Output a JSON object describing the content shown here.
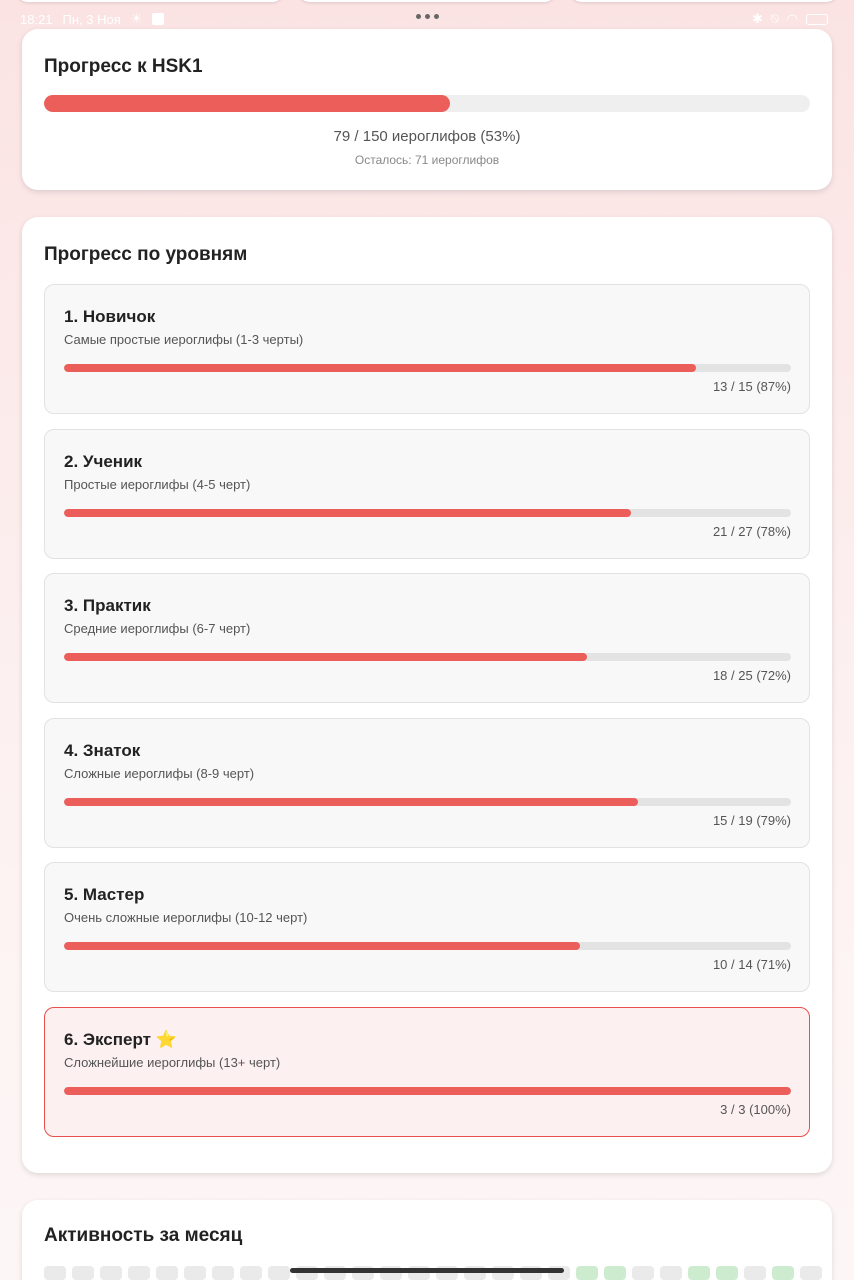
{
  "status_bar": {
    "time": "18:21",
    "date": "Пн, 3 Ноя"
  },
  "hsk": {
    "title": "Прогресс к HSK1",
    "progress": 0.53,
    "count_text": "79 / 150 иероглифов (53%)",
    "remaining_text": "Осталось: 71 иероглифов"
  },
  "levels": {
    "title": "Прогресс по уровням",
    "items": [
      {
        "name": "1. Новичок",
        "desc": "Самые простые иероглифы (1-3 черты)",
        "stat": "13 / 15 (87%)",
        "progress": 0.87
      },
      {
        "name": "2. Ученик",
        "desc": "Простые иероглифы (4-5 черт)",
        "stat": "21 / 27 (78%)",
        "progress": 0.78
      },
      {
        "name": "3. Практик",
        "desc": "Средние иероглифы (6-7 черт)",
        "stat": "18 / 25 (72%)",
        "progress": 0.72
      },
      {
        "name": "4. Знаток",
        "desc": "Сложные иероглифы (8-9 черт)",
        "stat": "15 / 19 (79%)",
        "progress": 0.79
      },
      {
        "name": "5. Мастер",
        "desc": "Очень сложные иероглифы (10-12 черт)",
        "stat": "10 / 14 (71%)",
        "progress": 0.71
      },
      {
        "name": "6. Эксперт",
        "name_icon": "⭐",
        "desc": "Сложнейшие иероглифы (13+ черт)",
        "stat": "3 / 3 (100%)",
        "progress": 1.0
      }
    ]
  },
  "activity": {
    "title": "Активность за месяц"
  },
  "colors": {
    "accent": "#ec5e5a",
    "active_border": "#e8504e"
  }
}
